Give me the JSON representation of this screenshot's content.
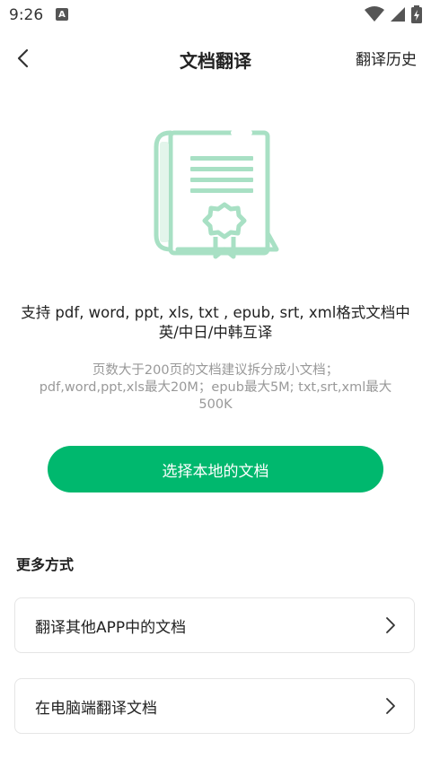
{
  "status_bar": {
    "time": "9:26",
    "app_icon_letter": "A"
  },
  "header": {
    "title": "文档翻译",
    "history_label": "翻译历史"
  },
  "intro": {
    "support_line1": "支持 pdf, word, ppt, xls, txt , epub, srt, xml格式文档中",
    "support_line2": "英/中日/中韩互译",
    "limit_line1": "页数大于200页的文档建议拆分成小文档；",
    "limit_line2": "pdf,word,ppt,xls最大20M；epub最大5M; txt,srt,xml最大",
    "limit_line3": "500K"
  },
  "actions": {
    "select_local_label": "选择本地的文档"
  },
  "more": {
    "section_title": "更多方式",
    "options": [
      {
        "label": "翻译其他APP中的文档"
      },
      {
        "label": "在电脑端翻译文档"
      }
    ]
  },
  "colors": {
    "accent": "#00b86e",
    "illustration": "#a8e0c4"
  }
}
